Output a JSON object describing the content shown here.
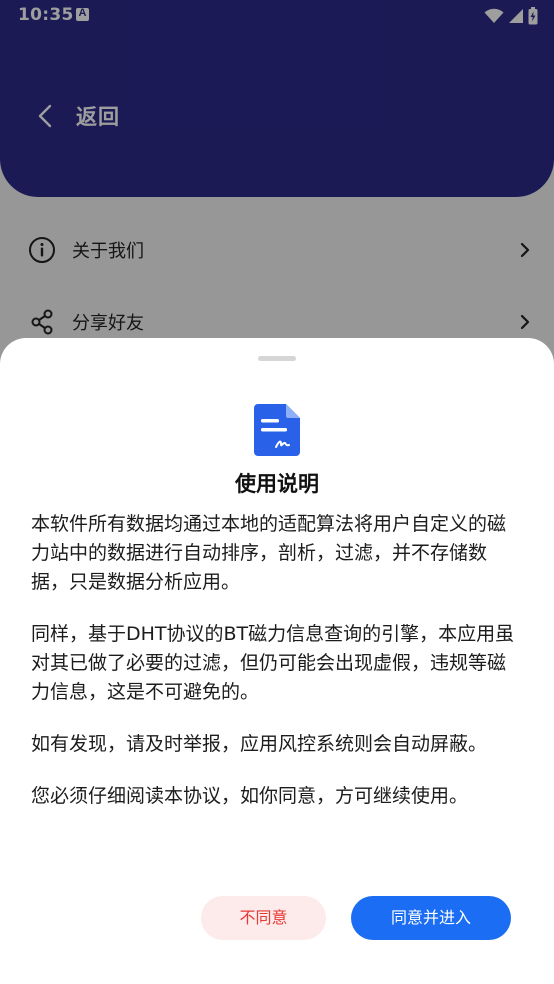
{
  "status_bar": {
    "time": "10:35",
    "notif_icon_letter": "A",
    "icons": [
      "wifi-icon",
      "signal-icon",
      "battery-icon"
    ]
  },
  "header": {
    "back_label": "返回",
    "color": "#2c2a8a"
  },
  "menu": {
    "items": [
      {
        "label": "关于我们",
        "icon": "info-icon"
      },
      {
        "label": "分享好友",
        "icon": "share-icon"
      }
    ]
  },
  "dialog": {
    "title": "使用说明",
    "icon": "document-signature-icon",
    "paragraphs": [
      "本软件所有数据均通过本地的适配算法将用户自定义的磁力站中的数据进行自动排序，剖析，过滤，并不存储数据，只是数据分析应用。",
      "同样，基于DHT协议的BT磁力信息查询的引擎，本应用虽对其已做了必要的过滤，但仍可能会出现虚假，违规等磁力信息，这是不可避免的。",
      "如有发现，请及时举报，应用风控系统则会自动屏蔽。",
      "您必须仔细阅读本协议，如你同意，方可继续使用。"
    ],
    "disagree_label": "不同意",
    "agree_label": "同意并进入",
    "accent_color": "#1b6ef3",
    "danger_color": "#e53935"
  }
}
